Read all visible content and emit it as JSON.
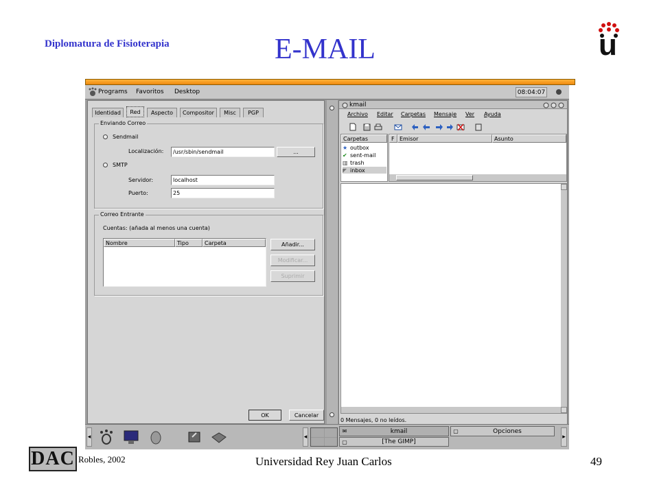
{
  "slide": {
    "header_left": "Diplomatura de Fisioterapia",
    "title": "E-MAIL",
    "footer_logo": "DAC",
    "footer_author": "Robles, 2002",
    "footer_center": "Universidad Rey Juan Carlos",
    "page_number": "49",
    "logo_letter": "u"
  },
  "topbar": {
    "menus": [
      "Programs",
      "Favoritos",
      "Desktop"
    ],
    "clock": "08:04:07"
  },
  "settings": {
    "tabs": [
      "Identidad",
      "Red",
      "Aspecto",
      "Compositor",
      "Misc",
      "PGP"
    ],
    "active_tab": "Red",
    "sending": {
      "legend": "Enviando Correo",
      "sendmail_label": "Sendmail",
      "location_label": "Localización:",
      "location_value": "/usr/sbin/sendmail",
      "browse_label": "...",
      "smtp_label": "SMTP",
      "server_label": "Servidor:",
      "server_value": "localhost",
      "port_label": "Puerto:",
      "port_value": "25"
    },
    "incoming": {
      "legend": "Correo Entrante",
      "accounts_label": "Cuentas:  (añada al menos una cuenta)",
      "columns": [
        "Nombre",
        "Tipo",
        "Carpeta"
      ],
      "add_label": "Añadir...",
      "modify_label": "Modificar...",
      "delete_label": "Suprimir"
    },
    "ok_label": "OK",
    "cancel_label": "Cancelar"
  },
  "kmail": {
    "title": "kmail",
    "menus": [
      "Archivo",
      "Editar",
      "Carpetas",
      "Mensaje",
      "Ver",
      "Ayuda"
    ],
    "folders_header": "Carpetas",
    "folders": [
      "outbox",
      "sent-mail",
      "trash",
      "inbox"
    ],
    "msg_columns": [
      "F",
      "Emisor",
      "Asunto"
    ],
    "status": "0 Mensajes, 0 no leídos."
  },
  "taskbar": {
    "tasks": [
      "kmail",
      "Opciones",
      "[The GIMP]"
    ]
  }
}
